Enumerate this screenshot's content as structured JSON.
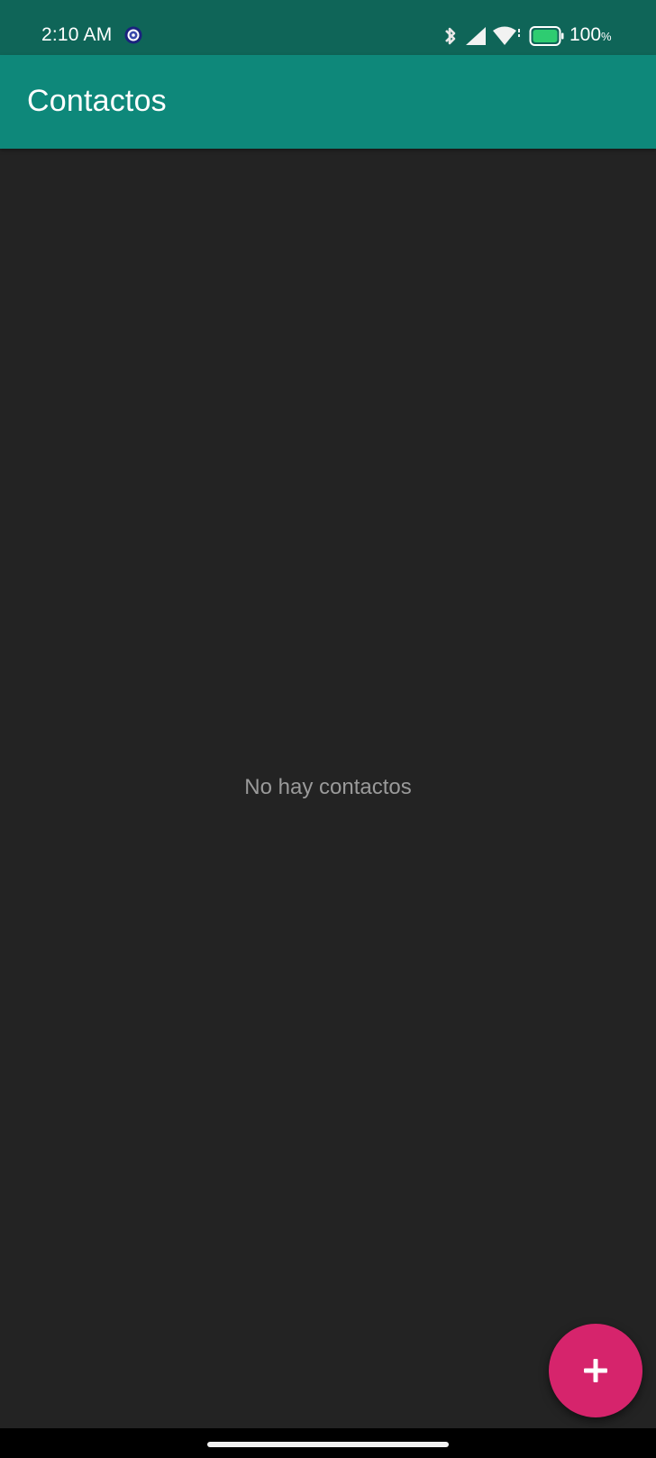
{
  "status_bar": {
    "time": "2:10 AM",
    "app_icon": "gear-badge-icon",
    "icons": [
      "bluetooth-icon",
      "signal-icon",
      "wifi-icon",
      "battery-icon"
    ],
    "battery_value": "100",
    "battery_unit": "%",
    "battery_level": 1.0,
    "battery_color": "#2ecc71"
  },
  "app_bar": {
    "title": "Contactos",
    "color": "#0e887a"
  },
  "content": {
    "empty_message": "No hay contactos"
  },
  "fab": {
    "icon": "plus-icon",
    "color": "#d6246c"
  },
  "colors": {
    "status_bar": "#0f6558",
    "background": "#232323",
    "empty_text": "#9a9a9a"
  }
}
